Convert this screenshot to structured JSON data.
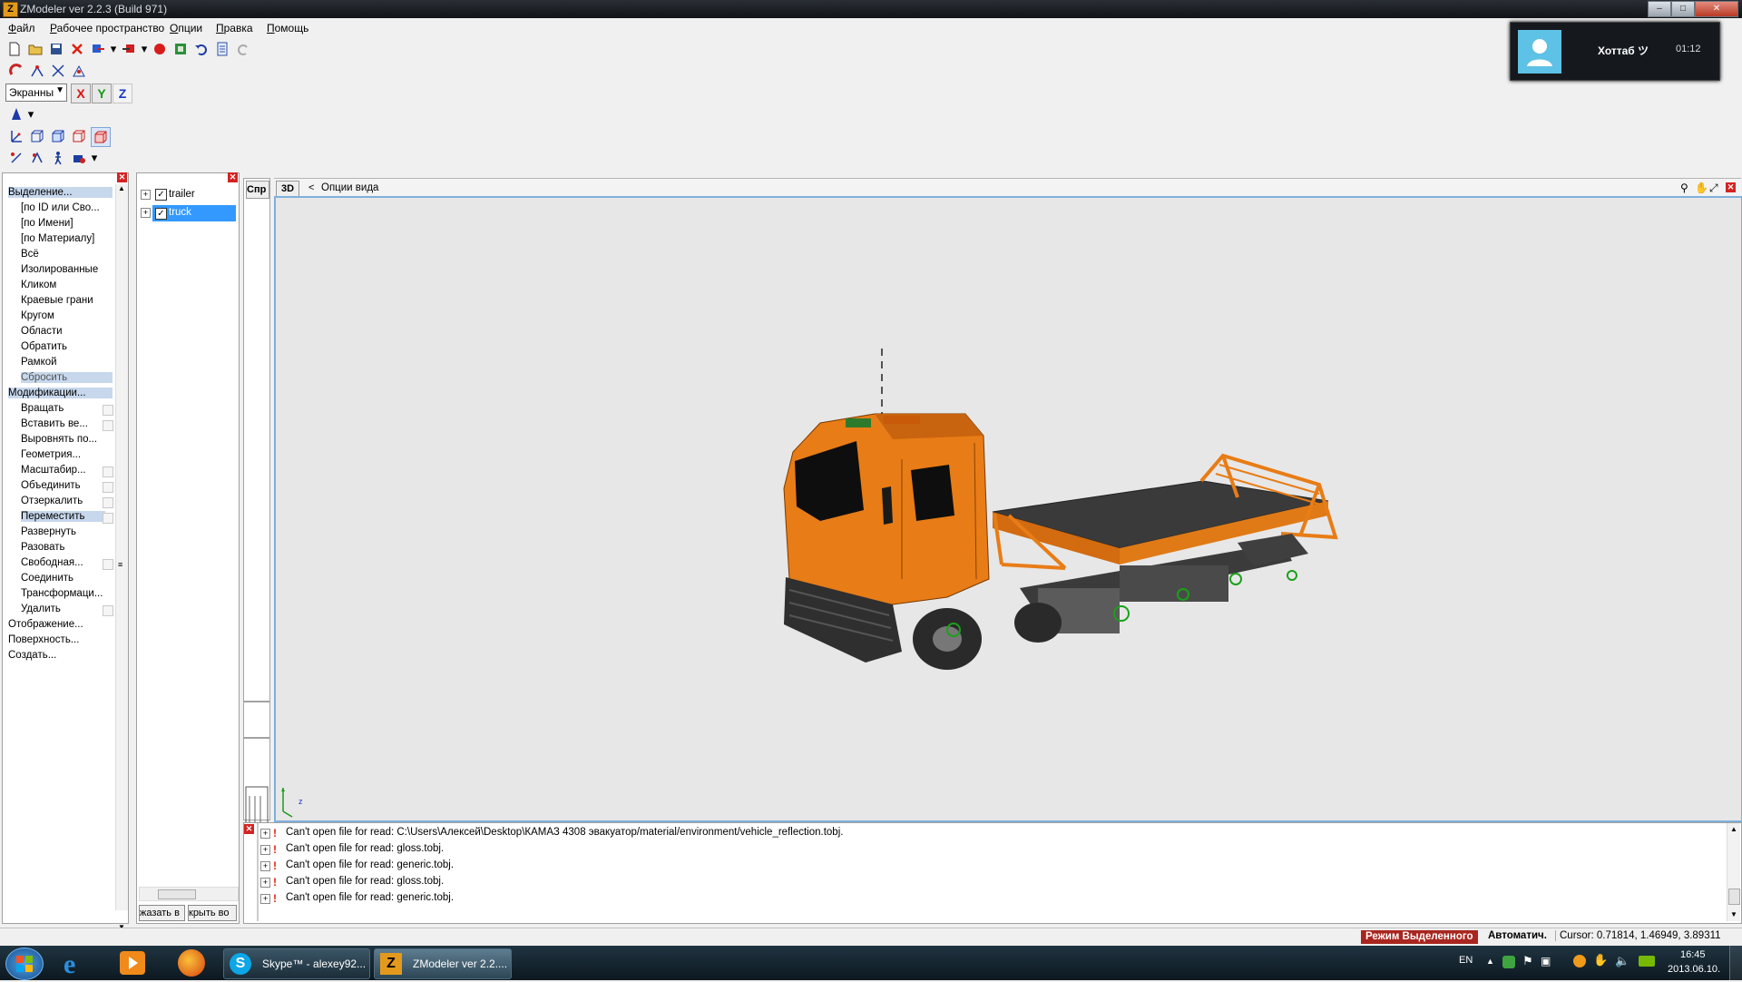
{
  "window": {
    "title": "ZModeler ver 2.2.3 (Build 971)",
    "app_icon": "Z"
  },
  "menu": [
    "Файл",
    "Рабочее пространство",
    "Опции",
    "Правка",
    "Помощь"
  ],
  "toolbar": {
    "screen_select": "Экранны",
    "axis_x": "X",
    "axis_y": "Y",
    "axis_z": "Z"
  },
  "skype_notification": {
    "name": "Хоттаб ツ",
    "time": "01:12"
  },
  "left_panel": {
    "selection_header": "Выделение...",
    "selection_items": [
      "[по ID или Сво...",
      "[по Имени]",
      "[по Материалу]",
      "Всё",
      "Изолированные",
      "Кликом",
      "Краевые грани",
      "Кругом",
      "Области",
      "Обратить",
      "Рамкой",
      "Сбросить"
    ],
    "modification_header": "Модификации...",
    "modification_items": [
      "Вращать",
      "Вставить ве...",
      "Выровнять по...",
      "Геометрия...",
      "Масштабир...",
      "Объединить",
      "Отзеркалить",
      "Переместить",
      "Развернуть",
      "Разовать",
      "Свободная...",
      "Соединить",
      "Трансформаци...",
      "Удалить"
    ],
    "bottom_headers": [
      "Отображение...",
      "Поверхность...",
      "Создать..."
    ]
  },
  "hierarchy": {
    "items": [
      {
        "label": "trailer",
        "checked": true,
        "selected": false
      },
      {
        "label": "truck",
        "checked": true,
        "selected": true
      }
    ],
    "show_button": "жазать в",
    "hide_button": "крыть во"
  },
  "side_tab": "Спр",
  "viewport": {
    "mode": "3D",
    "back": "<",
    "options": "Опции вида",
    "axis_label": "z",
    "colors": {
      "cab": "#e87c16",
      "bed": "#3a3a3a",
      "background": "#e7e7e7"
    }
  },
  "log": {
    "lines": [
      "Can't open file for read: C:\\Users\\Алексей\\Desktop\\КАМАЗ 4308 эвакуатор/material/environment/vehicle_reflection.tobj.",
      "Can't open file for read: gloss.tobj.",
      "Can't open file for read: generic.tobj.",
      "Can't open file for read: gloss.tobj.",
      "Can't open file for read: generic.tobj."
    ]
  },
  "status": {
    "mode": "Режим Выделенного",
    "auto": "Автоматич.",
    "cursor": "Cursor: 0.71814, 1.46949, 3.89311"
  },
  "taskbar": {
    "tasks": [
      "Skype™ - alexey92...",
      "ZModeler ver 2.2...."
    ],
    "language": "EN",
    "clock_time": "16:45",
    "clock_date": "2013.06.10."
  }
}
